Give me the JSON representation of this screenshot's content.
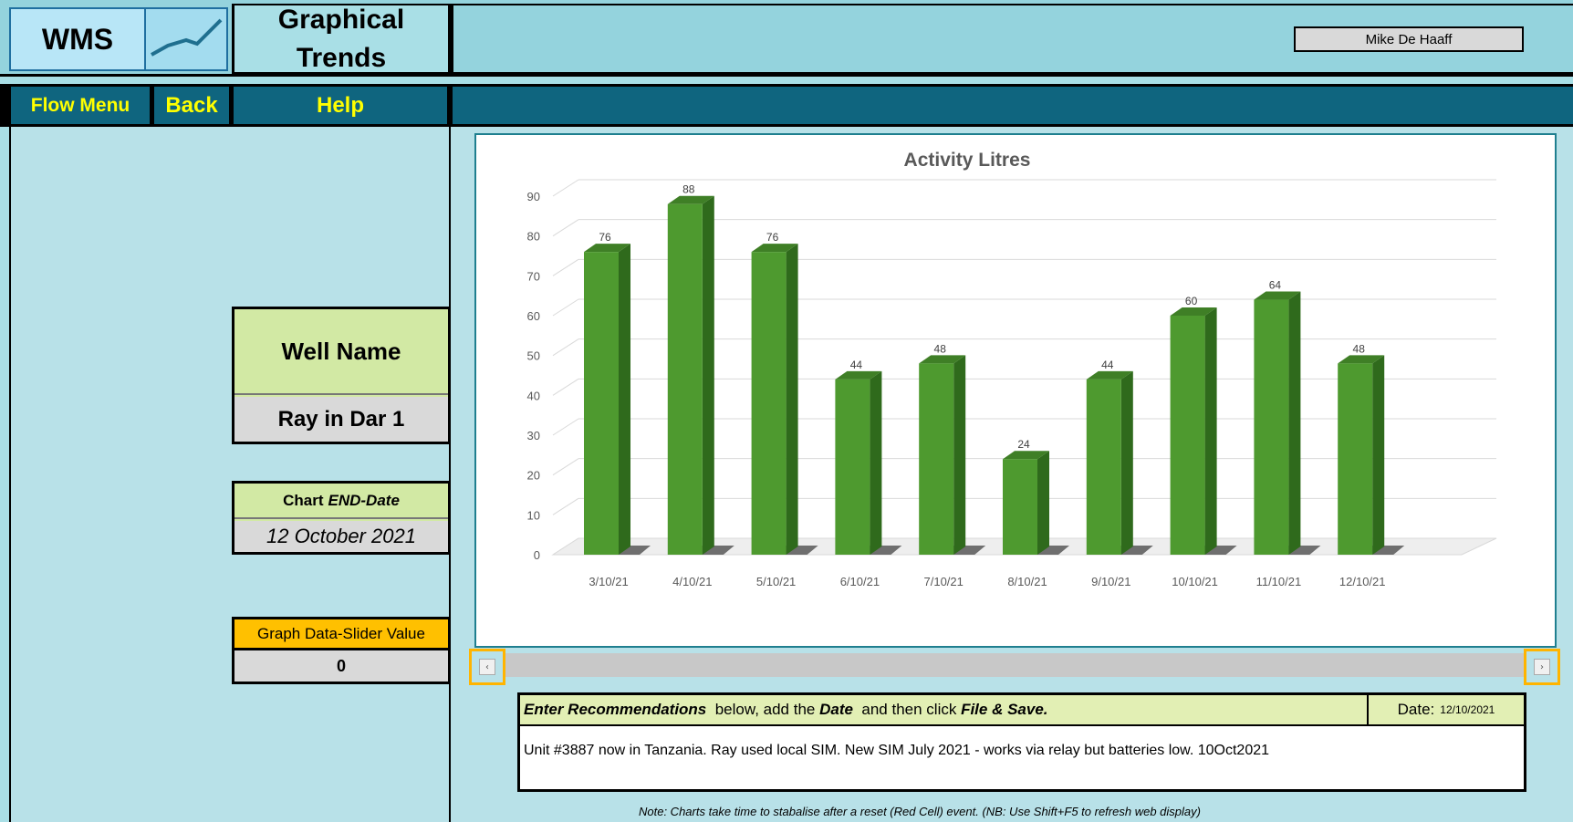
{
  "header": {
    "logo_text": "WMS",
    "title": "Graphical Trends",
    "user_name": "Mike De Haaff"
  },
  "nav": {
    "flow_menu": "Flow Menu",
    "back": "Back",
    "help": "Help"
  },
  "left_panel": {
    "well_name_label": "Well Name",
    "well_name_value": "Ray in Dar 1",
    "chart_end_label_prefix": "Chart",
    "chart_end_label_em": "END-Date",
    "chart_end_value": "12 October 2021",
    "slider_label": "Graph Data-Slider Value",
    "slider_value": "0"
  },
  "recommendations": {
    "instr_1": "Enter Recommendations",
    "instr_2": "  below, add the ",
    "instr_3": "Date",
    "instr_4": "  and then click ",
    "instr_5": "File & Save.",
    "date_label": "Date:",
    "date_value": "12/10/2021",
    "text": "Unit #3887 now in Tanzania. Ray  used local SIM. New SIM July 2021 - works via relay but batteries low. 10Oct2021"
  },
  "footnote": "Note: Charts take time to stabalise after a reset (Red Cell) event.  (NB: Use Shift+F5 to refresh web display)",
  "colors": {
    "bar": "#4e9a2f",
    "bar_top": "#3f7f26",
    "bar_side": "#2f6a1c",
    "accent_nav": "#0f657f",
    "nav_text": "#ffff00",
    "slider_label_bg": "#ffc000"
  },
  "chart_data": {
    "type": "bar",
    "title": "Activity Litres",
    "categories": [
      "3/10/21",
      "4/10/21",
      "5/10/21",
      "6/10/21",
      "7/10/21",
      "8/10/21",
      "9/10/21",
      "10/10/21",
      "11/10/21",
      "12/10/21"
    ],
    "values": [
      76,
      88,
      76,
      44,
      48,
      24,
      44,
      60,
      64,
      48
    ],
    "ylim": [
      0,
      90
    ],
    "yticks": [
      0,
      10,
      20,
      30,
      40,
      50,
      60,
      70,
      80,
      90
    ],
    "grid": true,
    "data_labels": true,
    "style": "3d-column"
  }
}
